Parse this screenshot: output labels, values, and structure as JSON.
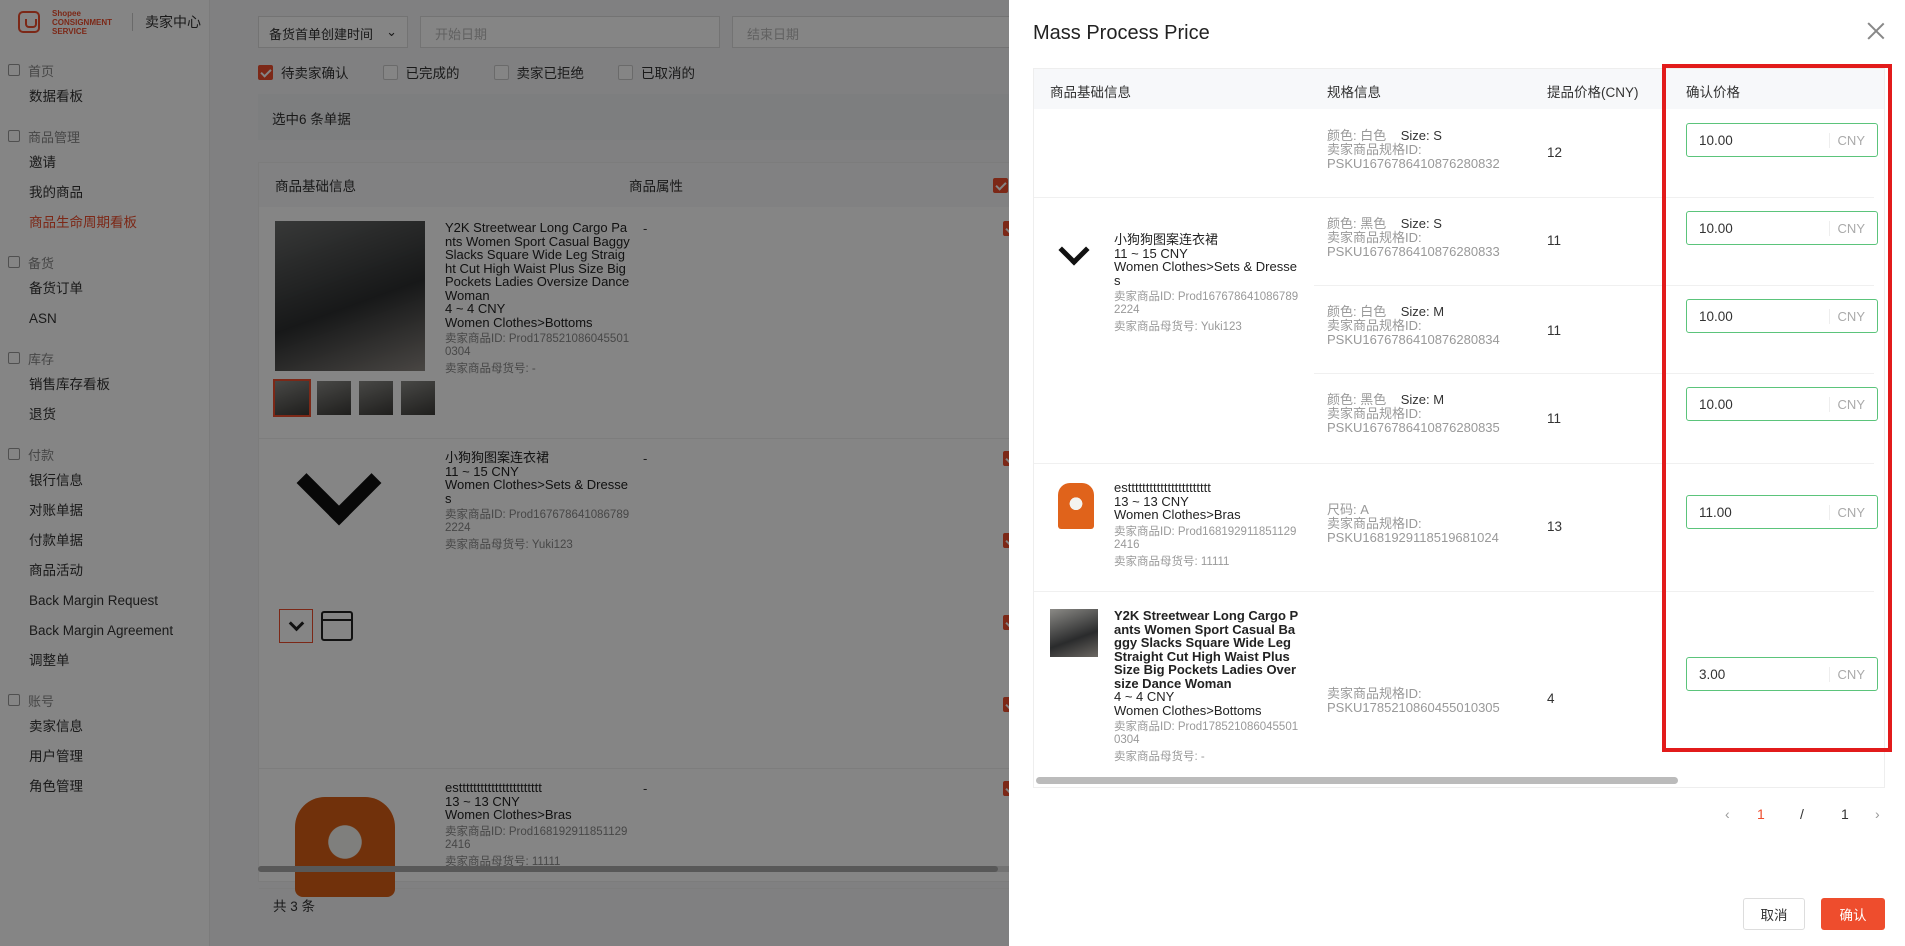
{
  "sidebar": {
    "logo_text": "Shopee CONSIGNMENT SERVICE",
    "center_label": "卖家中心",
    "groups": [
      {
        "title": "首页",
        "items": [
          "数据看板"
        ]
      },
      {
        "title": "商品管理",
        "items": [
          "邀请",
          "我的商品",
          "商品生命周期看板"
        ]
      },
      {
        "title": "备货",
        "items": [
          "备货订单",
          "ASN"
        ]
      },
      {
        "title": "库存",
        "items": [
          "销售库存看板",
          "退货"
        ]
      },
      {
        "title": "付款",
        "items": [
          "银行信息",
          "对账单据",
          "付款单据",
          "商品活动",
          "Back Margin Request",
          "Back Margin Agreement",
          "调整单"
        ]
      },
      {
        "title": "账号",
        "items": [
          "卖家信息",
          "用户管理",
          "角色管理"
        ]
      }
    ]
  },
  "main": {
    "filter_select": "备货首单创建时间",
    "start_date": "开始日期",
    "end_date": "结束日期",
    "status": [
      "待卖家确认",
      "已完成的",
      "卖家已拒绝",
      "已取消的"
    ],
    "selected_text": "选中6 条单据",
    "col_info": "商品基础信息",
    "col_attr": "商品属性",
    "rows": [
      {
        "title": "Y2K Streetwear Long Cargo Pants Women Sport Casual Baggy Slacks Square Wide Leg Straight Cut High Waist Plus Size Big Pockets Ladies Oversize Dance Woman",
        "price": "4 ~ 4 CNY",
        "category": "Women Clothes>Bottoms",
        "item_id": "卖家商品ID: Prod1785210860455010304",
        "parent_sku": "卖家商品母货号: -",
        "attr": "-"
      },
      {
        "title": "小狗狗图案连衣裙",
        "price": "11 ~ 15 CNY",
        "category": "Women Clothes>Sets & Dresses",
        "item_id": "卖家商品ID: Prod1676786410867892224",
        "parent_sku": "卖家商品母货号: Yuki123",
        "attr": "-"
      },
      {
        "title": "esttttttttttttttttttttttt",
        "price": "13 ~ 13 CNY",
        "category": "Women Clothes>Bras",
        "item_id": "卖家商品ID: Prod1681929118511292416",
        "parent_sku": "卖家商品母货号: 11111",
        "attr": "-"
      }
    ],
    "total": "共 3 条"
  },
  "drawer": {
    "title": "Mass Process Price",
    "headers": [
      "商品基础信息",
      "规格信息",
      "提品价格(CNY)",
      "确认价格"
    ],
    "products": [
      {
        "title": "小狗狗图案连衣裙",
        "price": "11 ~ 15 CNY",
        "category": "Women Clothes>Sets & Dresses",
        "item_id": "卖家商品ID: Prod1676786410867892224",
        "parent_sku": "卖家商品母货号: Yuki123"
      },
      {
        "title": "esttttttttttttttttttttttt",
        "price": "13 ~ 13 CNY",
        "category": "Women Clothes>Bras",
        "item_id": "卖家商品ID: Prod1681929118511292416",
        "parent_sku": "卖家商品母货号: 11111"
      },
      {
        "title": "Y2K Streetwear Long Cargo Pants Women Sport Casual Baggy Slacks Square Wide Leg Straight Cut High Waist Plus Size Big Pockets Ladies Oversize Dance Woman",
        "price": "4 ~ 4 CNY",
        "category": "Women Clothes>Bottoms",
        "item_id": "卖家商品ID: Prod1785210860455010304",
        "parent_sku": "卖家商品母货号: -"
      }
    ],
    "specs": [
      {
        "attr1": "颜色: 白色",
        "attr2": "Size: S",
        "sku_label": "卖家商品规格ID:",
        "sku": "PSKU1676786410876280832",
        "price": "12",
        "confirm": "10.00"
      },
      {
        "attr1": "颜色: 黑色",
        "attr2": "Size: S",
        "sku_label": "卖家商品规格ID:",
        "sku": "PSKU1676786410876280833",
        "price": "11",
        "confirm": "10.00"
      },
      {
        "attr1": "颜色: 白色",
        "attr2": "Size: M",
        "sku_label": "卖家商品规格ID:",
        "sku": "PSKU1676786410876280834",
        "price": "11",
        "confirm": "10.00"
      },
      {
        "attr1": "颜色: 黑色",
        "attr2": "Size: M",
        "sku_label": "卖家商品规格ID:",
        "sku": "PSKU1676786410876280835",
        "price": "11",
        "confirm": "10.00"
      },
      {
        "attr1": "尺码: A",
        "attr2": "",
        "sku_label": "卖家商品规格ID:",
        "sku": "PSKU1681929118519681024",
        "price": "13",
        "confirm": "11.00"
      },
      {
        "attr1": "",
        "attr2": "",
        "sku_label": "卖家商品规格ID:",
        "sku": "PSKU1785210860455010305",
        "price": "4",
        "confirm": "3.00"
      }
    ],
    "currency": "CNY",
    "pager": {
      "current": "1",
      "sep": "/",
      "total": "1"
    },
    "cancel": "取消",
    "confirm": "确认"
  },
  "colors": {
    "accent": "#ee4d2d",
    "input_border": "#5bc47b",
    "highlight": "#e21b1b"
  }
}
